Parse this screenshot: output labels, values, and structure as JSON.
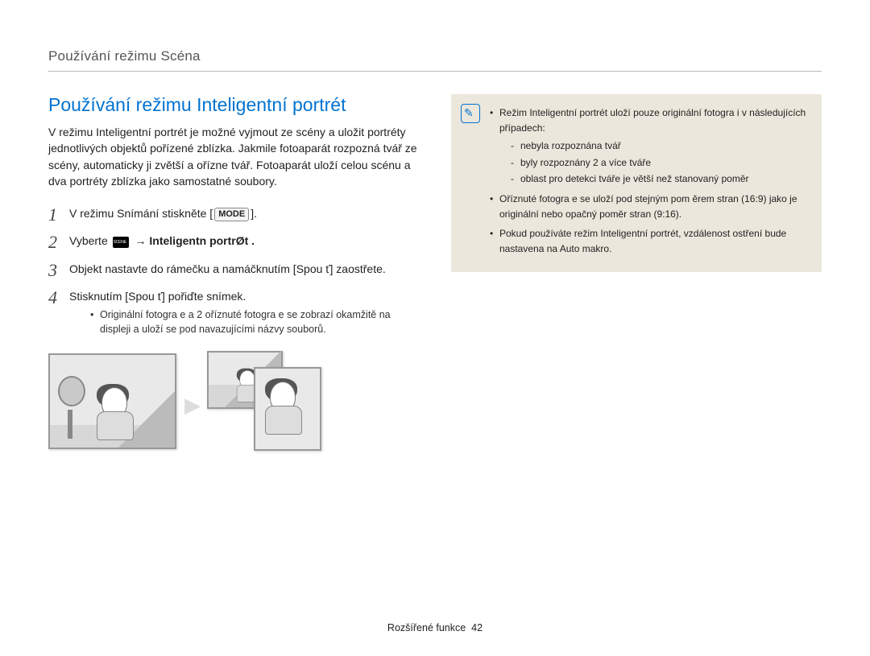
{
  "breadcrumb": "Používání režimu Scéna",
  "section_title": "Používání režimu Inteligentní portrét",
  "intro": "V režimu Inteligentní portrét je možné vyjmout ze scény a uložit portréty jednotlivých objektů pořízené zblízka. Jakmile fotoaparát rozpozná tvář ze scény, automaticky ji zvětší a ořízne tvář. Fotoaparát uloží celou scénu a dva portréty zblízka jako samostatné soubory.",
  "steps": {
    "s1_a": "V režimu Snímání stiskněte [",
    "s1_mode": "MODE",
    "s1_b": "].",
    "s2_a": "Vyberte ",
    "s2_arrow": " → ",
    "s2_b": "Inteligentn portrØt .",
    "s3": "Objekt nastavte do rámečku a namáčknutím [Spou  ť] zaostřete.",
    "s4": "Stisknutím [Spou  ť] pořiďte snímek.",
    "s4_sub": "Originální fotogra e a 2 oříznuté fotogra e se zobrazí okamžitě na displeji a uloží se pod navazujícími názvy souborů."
  },
  "note": {
    "b1": "Režim Inteligentní portrét uloží pouze originální fotogra i v následujících případech:",
    "d1": "nebyla rozpoznána tvář",
    "d2": "byly rozpoznány 2 a více tváře",
    "d3": "oblast pro detekci tváře je větší než stanovaný poměr",
    "b2": "Oříznuté fotogra e se uloží pod stejným pom ěrem stran (16:9) jako je originální nebo opačný poměr stran (9:16).",
    "b3": "Pokud používáte režim Inteligentní portrét, vzdálenost ostření bude nastavena na Auto makro."
  },
  "footer_label": "Rozšířené funkce",
  "footer_page": "42"
}
